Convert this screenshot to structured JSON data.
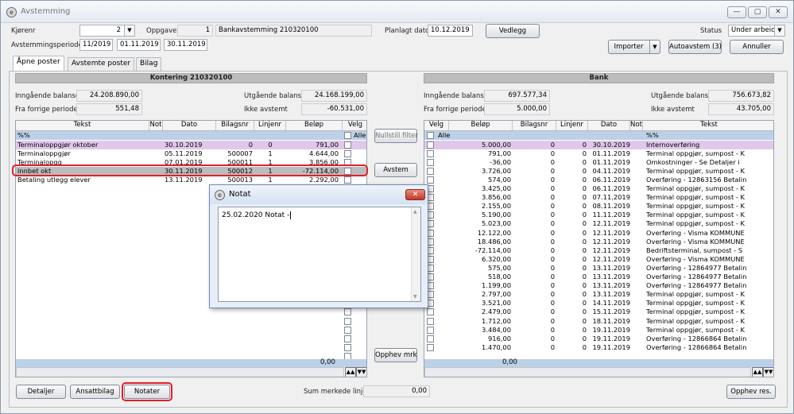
{
  "window": {
    "title": "Avstemming"
  },
  "header": {
    "kjorenr_label": "Kjørenr",
    "kjorenr_value": "2",
    "oppgave_label": "Oppgave",
    "oppgave_num": "1",
    "oppgave_name": "Bankavstemming 210320100",
    "planlagt_label": "Planlagt dato",
    "planlagt_value": "10.12.2019",
    "vedlegg": "Vedlegg",
    "status_label": "Status",
    "status_value": "Under arbeic",
    "periode_label": "Avstemmingsperiode",
    "periode": "11/2019",
    "fra": "01.11.2019",
    "til": "30.11.2019",
    "importer": "Importer",
    "autoavstem": "Autoavstem (3)",
    "annuller": "Annuller"
  },
  "tabs": [
    "Åpne poster",
    "Avstemte poster",
    "Bilag"
  ],
  "left": {
    "title": "Kontering 210320100",
    "inngaende_label": "Inngående balanse",
    "inngaende": "24.208.890,00",
    "fra_forrige_label": "Fra forrige periode",
    "fra_forrige": "551,48",
    "utgaende_label": "Utgående balanse",
    "utgaende": "24.168.199,00",
    "ikke_avstemt_label": "Ikke avstemt",
    "ikke_avstemt": "-60.531,00",
    "columns": [
      "Tekst",
      "Not",
      "Dato",
      "Bilagsnr",
      "Linjenr",
      "Beløp",
      "Velg"
    ],
    "filter": "%%",
    "alle": "Alle",
    "rows": [
      {
        "tekst": "Terminaloppgjør oktober",
        "dato": "30.10.2019",
        "bilag": "0",
        "linje": "0",
        "belop": "791,00"
      },
      {
        "tekst": "Terminaloppgjør",
        "dato": "05.11.2019",
        "bilag": "500007",
        "linje": "1",
        "belop": "4.644,00"
      },
      {
        "tekst": "Terminalopgg",
        "dato": "07.01.2019",
        "bilag": "500011",
        "linje": "1",
        "belop": "3.856,00"
      },
      {
        "tekst": "innbet okt",
        "dato": "30.11.2019",
        "bilag": "500012",
        "linje": "1",
        "belop": "-72.114,00"
      },
      {
        "tekst": "Betaling utlegg elever",
        "dato": "13.11.2019",
        "bilag": "500013",
        "linje": "1",
        "belop": "2.292,00"
      }
    ],
    "sum": "0,00"
  },
  "middle": {
    "nullstill": "Nullstill filter",
    "avstem": "Avstem",
    "opphev_mrk": "Opphev mrk"
  },
  "right": {
    "title": "Bank",
    "inngaende_label": "Inngående balanse",
    "inngaende": "697.577,34",
    "fra_forrige_label": "Fra forrige periode",
    "fra_forrige": "5.000,00",
    "utgaende_label": "Utgående balanse",
    "utgaende": "756.673,82",
    "ikke_avstemt_label": "Ikke avstemt",
    "ikke_avstemt": "43.705,00",
    "columns": [
      "Velg",
      "Beløp",
      "Bilagsnr",
      "Linjenr",
      "Dato",
      "Not",
      "Tekst"
    ],
    "filter": "%%",
    "alle": "Alle",
    "rows": [
      {
        "belop": "5.000,00",
        "bilag": "0",
        "linje": "0",
        "dato": "30.10.2019",
        "tekst": "Internoverføring"
      },
      {
        "belop": "791,00",
        "bilag": "0",
        "linje": "0",
        "dato": "01.11.2019",
        "tekst": "Terminal oppgjør, sumpost - K"
      },
      {
        "belop": "-36,00",
        "bilag": "0",
        "linje": "0",
        "dato": "01.11.2019",
        "tekst": "Omkostninger - Se Detaljer i"
      },
      {
        "belop": "3.726,00",
        "bilag": "0",
        "linje": "0",
        "dato": "04.11.2019",
        "tekst": "Terminal oppgjør, sumpost - K"
      },
      {
        "belop": "574,00",
        "bilag": "0",
        "linje": "0",
        "dato": "06.11.2019",
        "tekst": "Overføring - 12863156 Betalin"
      },
      {
        "belop": "3.425,00",
        "bilag": "0",
        "linje": "0",
        "dato": "06.11.2019",
        "tekst": "Terminal oppgjør, sumpost - K"
      },
      {
        "belop": "3.856,00",
        "bilag": "0",
        "linje": "0",
        "dato": "07.11.2019",
        "tekst": "Terminal oppgjør, sumpost - K"
      },
      {
        "belop": "2.155,00",
        "bilag": "0",
        "linje": "0",
        "dato": "08.11.2019",
        "tekst": "Terminal oppgjør, sumpost - K"
      },
      {
        "belop": "5.190,00",
        "bilag": "0",
        "linje": "0",
        "dato": "11.11.2019",
        "tekst": "Terminal oppgjør, sumpost - K"
      },
      {
        "belop": "5.023,00",
        "bilag": "0",
        "linje": "0",
        "dato": "12.11.2019",
        "tekst": "Terminal oppgjør, sumpost - K"
      },
      {
        "belop": "12.122,00",
        "bilag": "0",
        "linje": "0",
        "dato": "12.11.2019",
        "tekst": "Overføring - Visma KOMMUNE"
      },
      {
        "belop": "18.486,00",
        "bilag": "0",
        "linje": "0",
        "dato": "12.11.2019",
        "tekst": "Overføring - Visma KOMMUNE"
      },
      {
        "belop": "-72.114,00",
        "bilag": "0",
        "linje": "0",
        "dato": "12.11.2019",
        "tekst": "Bedriftsterminal, sumpost - S"
      },
      {
        "belop": "6.320,00",
        "bilag": "0",
        "linje": "0",
        "dato": "12.11.2019",
        "tekst": "Overføring - Visma KOMMUNE"
      },
      {
        "belop": "575,00",
        "bilag": "0",
        "linje": "0",
        "dato": "13.11.2019",
        "tekst": "Overføring - 12864977 Betalin"
      },
      {
        "belop": "518,00",
        "bilag": "0",
        "linje": "0",
        "dato": "13.11.2019",
        "tekst": "Overføring - 12864977 Betalin"
      },
      {
        "belop": "1.199,00",
        "bilag": "0",
        "linje": "0",
        "dato": "13.11.2019",
        "tekst": "Overføring - 12864977 Betalin"
      },
      {
        "belop": "2.797,00",
        "bilag": "0",
        "linje": "0",
        "dato": "13.11.2019",
        "tekst": "Terminal oppgjør, sumpost - K"
      },
      {
        "belop": "3.521,00",
        "bilag": "0",
        "linje": "0",
        "dato": "14.11.2019",
        "tekst": "Terminal oppgjør, sumpost - K"
      },
      {
        "belop": "2.479,00",
        "bilag": "0",
        "linje": "0",
        "dato": "15.11.2019",
        "tekst": "Terminal oppgjør, sumpost - K"
      },
      {
        "belop": "1.712,00",
        "bilag": "0",
        "linje": "0",
        "dato": "18.11.2019",
        "tekst": "Terminal oppgjør, sumpost - K"
      },
      {
        "belop": "3.484,00",
        "bilag": "0",
        "linje": "0",
        "dato": "19.11.2019",
        "tekst": "Terminal oppgjør, sumpost - K"
      },
      {
        "belop": "916,00",
        "bilag": "0",
        "linje": "0",
        "dato": "19.11.2019",
        "tekst": "Overføring - 12866864 Betalin"
      },
      {
        "belop": "1.470,00",
        "bilag": "0",
        "linje": "0",
        "dato": "19.11.2019",
        "tekst": "Overføring - 12866864 Betalin"
      }
    ],
    "sum": "0,00"
  },
  "bottom": {
    "detaljer": "Detaljer",
    "ansattbilag": "Ansattbilag",
    "notater": "Notater",
    "sum_label": "Sum merkede linjer",
    "sum_value": "0,00",
    "opphev_res": "Opphev res."
  },
  "dialog": {
    "title": "Notat",
    "text": "25.02.2020 Notat - "
  },
  "colors": {
    "filter_row": "#bcd1e8",
    "purple_row": "#e0c8ea",
    "selected_row": "#bcbcbc",
    "highlight": "#e0202c"
  }
}
